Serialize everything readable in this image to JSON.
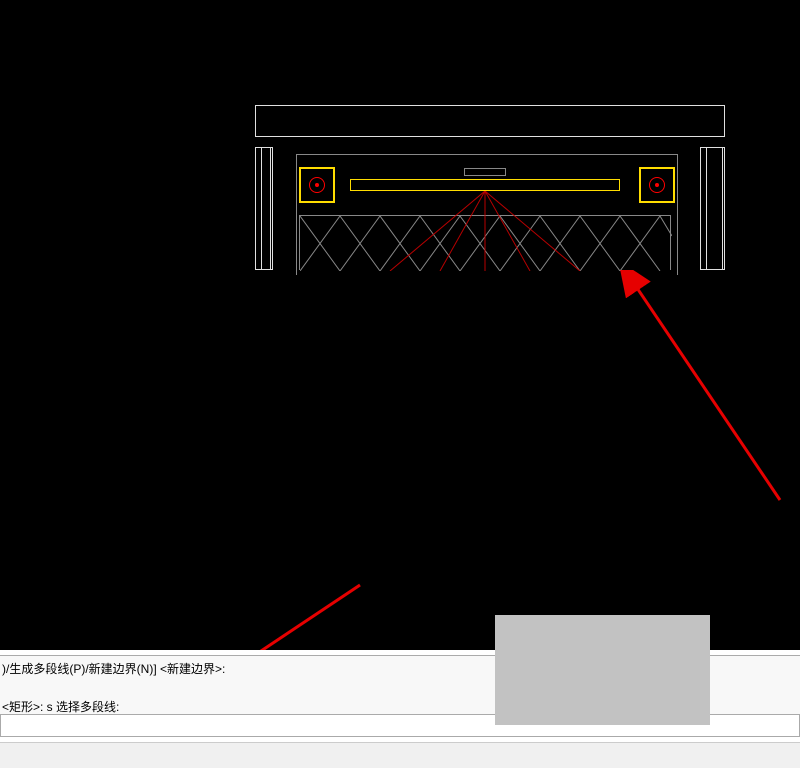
{
  "command": {
    "history_line1": ")/生成多段线(P)/新建边界(N)] <新建边界>:",
    "history_line2": "<矩形>: s 选择多段线:",
    "input_value": ""
  },
  "colors": {
    "viewport_bg": "#000000",
    "edge": "#e0e0e0",
    "highlight": "#ffdd00",
    "accent": "#ff0000",
    "annotation": "#e60000"
  }
}
